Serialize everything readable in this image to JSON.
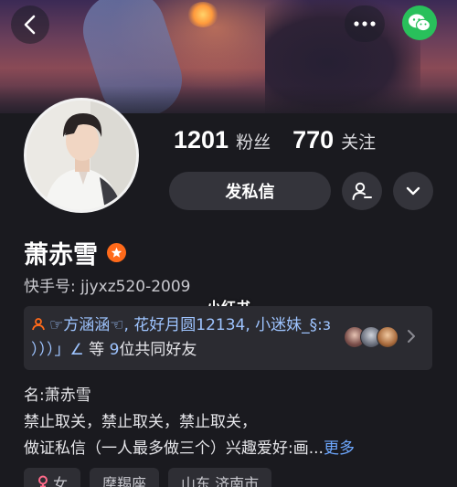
{
  "header": {
    "back_icon": "chevron-left-icon",
    "more_icon": "ellipsis-icon",
    "share_icon": "wechat-icon",
    "share_color": "#29c05b"
  },
  "profile": {
    "followers_count": "1201",
    "followers_label": "粉丝",
    "following_count": "770",
    "following_label": "关注",
    "private_message_label": "发私信",
    "name": "萧赤雪",
    "verified_color": "#ff6a1a",
    "kuaishou_id": "快手号: jjyxz520-2009"
  },
  "watermark": "小红书",
  "mutual_friends": {
    "friend_names": "☞方涵涵☜, 花好月圆12134, 小迷妹_§:з ）））」∠",
    "text_prefix": "等",
    "count": "9",
    "text_suffix": "位共同好友"
  },
  "bio": {
    "line1": "名:萧赤雪",
    "line2": "禁止取关，禁止取关，禁止取关，",
    "line3": "做证私信（一人最多做三个）兴趣爱好:画...",
    "more_label": "更多"
  },
  "tags": [
    "女",
    "摩羯座",
    "山东 济南市"
  ],
  "colors": {
    "background": "#1a1a1f",
    "link": "#9ec4ff",
    "more_link": "#6ea8ff"
  }
}
